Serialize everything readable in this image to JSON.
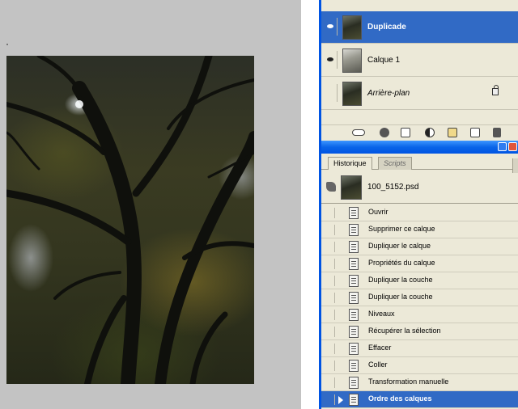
{
  "layers": [
    {
      "name": "Duplicade",
      "visible": true,
      "selected": true,
      "italic": false,
      "locked": false,
      "thumb": "tree-dark"
    },
    {
      "name": "Calque 1",
      "visible": true,
      "selected": false,
      "italic": false,
      "locked": false,
      "thumb": "tree-light"
    },
    {
      "name": "Arrière-plan",
      "visible": false,
      "selected": false,
      "italic": true,
      "locked": true,
      "thumb": "tree-dark"
    }
  ],
  "layers_toolbar_icons": [
    "link-icon",
    "layer-style-icon",
    "mask-icon",
    "adjustment-icon",
    "folder-icon",
    "new-layer-icon",
    "trash-icon"
  ],
  "history_tabs": [
    "Historique",
    "Scripts"
  ],
  "history_snapshot": {
    "name": "100_5152.psd"
  },
  "history_items": [
    "Ouvrir",
    "Supprimer ce calque",
    "Dupliquer le calque",
    "Propriétés du calque",
    "Dupliquer la couche",
    "Dupliquer la couche",
    "Niveaux",
    "Récupérer la sélection",
    "Effacer",
    "Coller",
    "Transformation manuelle",
    "Ordre des calques"
  ],
  "history_selected": "Ordre des calques",
  "colors": {
    "selection_blue": "#316ac5",
    "titlebar_blue": "#0054e3",
    "panel_bg": "#ece9d8",
    "canvas_bg": "#c3c3c3"
  }
}
